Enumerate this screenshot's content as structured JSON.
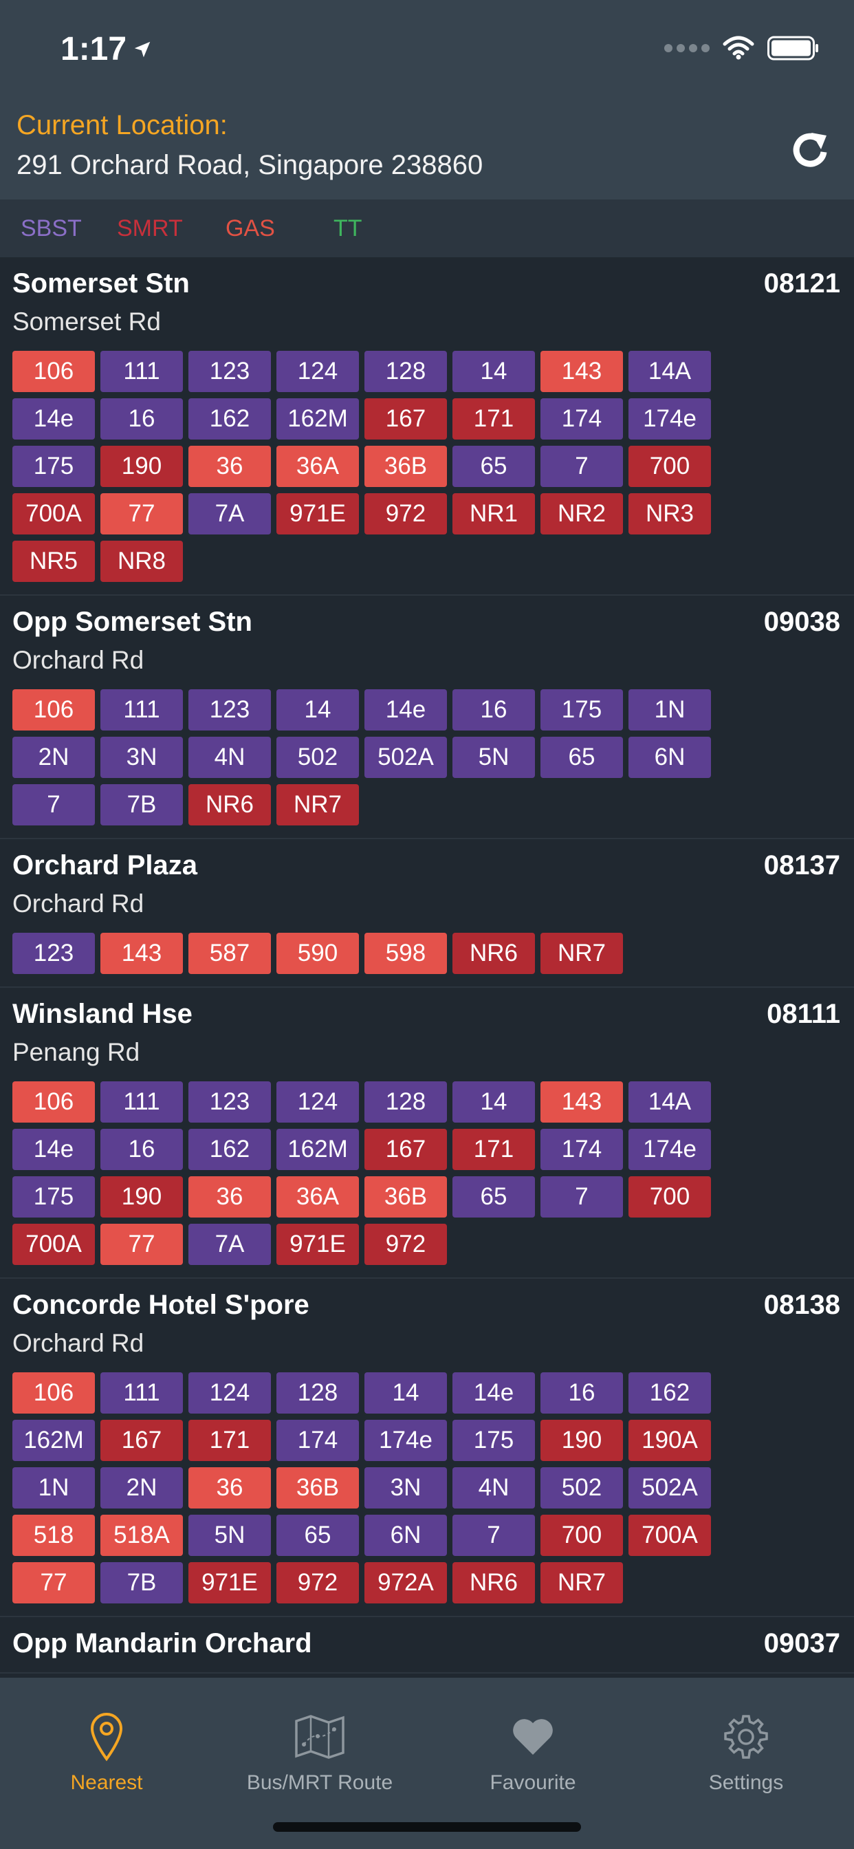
{
  "status": {
    "time": "1:17"
  },
  "header": {
    "location_label": "Current Location:",
    "address": "291 Orchard Road, Singapore 238860"
  },
  "legend": [
    {
      "label": "SBST",
      "color": "#8b6fc7"
    },
    {
      "label": "SMRT",
      "color": "#c8303b"
    },
    {
      "label": "GAS",
      "color": "#e25244"
    },
    {
      "label": "TT",
      "color": "#3fb55e"
    }
  ],
  "operator_colors": {
    "SBST": "#5c3f91",
    "SMRT": "#b22a32",
    "GAS": "#e4524b",
    "TT": "#2e9b4b"
  },
  "stops": [
    {
      "name": "Somerset Stn",
      "code": "08121",
      "road": "Somerset Rd",
      "services": [
        [
          "106",
          "GAS"
        ],
        [
          "111",
          "SBST"
        ],
        [
          "123",
          "SBST"
        ],
        [
          "124",
          "SBST"
        ],
        [
          "128",
          "SBST"
        ],
        [
          "14",
          "SBST"
        ],
        [
          "143",
          "GAS"
        ],
        [
          "14A",
          "SBST"
        ],
        [
          "14e",
          "SBST"
        ],
        [
          "16",
          "SBST"
        ],
        [
          "162",
          "SBST"
        ],
        [
          "162M",
          "SBST"
        ],
        [
          "167",
          "SMRT"
        ],
        [
          "171",
          "SMRT"
        ],
        [
          "174",
          "SBST"
        ],
        [
          "174e",
          "SBST"
        ],
        [
          "175",
          "SBST"
        ],
        [
          "190",
          "SMRT"
        ],
        [
          "36",
          "GAS"
        ],
        [
          "36A",
          "GAS"
        ],
        [
          "36B",
          "GAS"
        ],
        [
          "65",
          "SBST"
        ],
        [
          "7",
          "SBST"
        ],
        [
          "700",
          "SMRT"
        ],
        [
          "700A",
          "SMRT"
        ],
        [
          "77",
          "GAS"
        ],
        [
          "7A",
          "SBST"
        ],
        [
          "971E",
          "SMRT"
        ],
        [
          "972",
          "SMRT"
        ],
        [
          "NR1",
          "SMRT"
        ],
        [
          "NR2",
          "SMRT"
        ],
        [
          "NR3",
          "SMRT"
        ],
        [
          "NR5",
          "SMRT"
        ],
        [
          "NR8",
          "SMRT"
        ]
      ]
    },
    {
      "name": "Opp Somerset Stn",
      "code": "09038",
      "road": "Orchard Rd",
      "services": [
        [
          "106",
          "GAS"
        ],
        [
          "111",
          "SBST"
        ],
        [
          "123",
          "SBST"
        ],
        [
          "14",
          "SBST"
        ],
        [
          "14e",
          "SBST"
        ],
        [
          "16",
          "SBST"
        ],
        [
          "175",
          "SBST"
        ],
        [
          "1N",
          "SBST"
        ],
        [
          "2N",
          "SBST"
        ],
        [
          "3N",
          "SBST"
        ],
        [
          "4N",
          "SBST"
        ],
        [
          "502",
          "SBST"
        ],
        [
          "502A",
          "SBST"
        ],
        [
          "5N",
          "SBST"
        ],
        [
          "65",
          "SBST"
        ],
        [
          "6N",
          "SBST"
        ],
        [
          "7",
          "SBST"
        ],
        [
          "7B",
          "SBST"
        ],
        [
          "NR6",
          "SMRT"
        ],
        [
          "NR7",
          "SMRT"
        ]
      ]
    },
    {
      "name": "Orchard Plaza",
      "code": "08137",
      "road": "Orchard Rd",
      "services": [
        [
          "123",
          "SBST"
        ],
        [
          "143",
          "GAS"
        ],
        [
          "587",
          "GAS"
        ],
        [
          "590",
          "GAS"
        ],
        [
          "598",
          "GAS"
        ],
        [
          "NR6",
          "SMRT"
        ],
        [
          "NR7",
          "SMRT"
        ]
      ]
    },
    {
      "name": "Winsland Hse",
      "code": "08111",
      "road": "Penang Rd",
      "services": [
        [
          "106",
          "GAS"
        ],
        [
          "111",
          "SBST"
        ],
        [
          "123",
          "SBST"
        ],
        [
          "124",
          "SBST"
        ],
        [
          "128",
          "SBST"
        ],
        [
          "14",
          "SBST"
        ],
        [
          "143",
          "GAS"
        ],
        [
          "14A",
          "SBST"
        ],
        [
          "14e",
          "SBST"
        ],
        [
          "16",
          "SBST"
        ],
        [
          "162",
          "SBST"
        ],
        [
          "162M",
          "SBST"
        ],
        [
          "167",
          "SMRT"
        ],
        [
          "171",
          "SMRT"
        ],
        [
          "174",
          "SBST"
        ],
        [
          "174e",
          "SBST"
        ],
        [
          "175",
          "SBST"
        ],
        [
          "190",
          "SMRT"
        ],
        [
          "36",
          "GAS"
        ],
        [
          "36A",
          "GAS"
        ],
        [
          "36B",
          "GAS"
        ],
        [
          "65",
          "SBST"
        ],
        [
          "7",
          "SBST"
        ],
        [
          "700",
          "SMRT"
        ],
        [
          "700A",
          "SMRT"
        ],
        [
          "77",
          "GAS"
        ],
        [
          "7A",
          "SBST"
        ],
        [
          "971E",
          "SMRT"
        ],
        [
          "972",
          "SMRT"
        ]
      ]
    },
    {
      "name": "Concorde Hotel S'pore",
      "code": "08138",
      "road": "Orchard Rd",
      "services": [
        [
          "106",
          "GAS"
        ],
        [
          "111",
          "SBST"
        ],
        [
          "124",
          "SBST"
        ],
        [
          "128",
          "SBST"
        ],
        [
          "14",
          "SBST"
        ],
        [
          "14e",
          "SBST"
        ],
        [
          "16",
          "SBST"
        ],
        [
          "162",
          "SBST"
        ],
        [
          "162M",
          "SBST"
        ],
        [
          "167",
          "SMRT"
        ],
        [
          "171",
          "SMRT"
        ],
        [
          "174",
          "SBST"
        ],
        [
          "174e",
          "SBST"
        ],
        [
          "175",
          "SBST"
        ],
        [
          "190",
          "SMRT"
        ],
        [
          "190A",
          "SMRT"
        ],
        [
          "1N",
          "SBST"
        ],
        [
          "2N",
          "SBST"
        ],
        [
          "36",
          "GAS"
        ],
        [
          "36B",
          "GAS"
        ],
        [
          "3N",
          "SBST"
        ],
        [
          "4N",
          "SBST"
        ],
        [
          "502",
          "SBST"
        ],
        [
          "502A",
          "SBST"
        ],
        [
          "518",
          "GAS"
        ],
        [
          "518A",
          "GAS"
        ],
        [
          "5N",
          "SBST"
        ],
        [
          "65",
          "SBST"
        ],
        [
          "6N",
          "SBST"
        ],
        [
          "7",
          "SBST"
        ],
        [
          "700",
          "SMRT"
        ],
        [
          "700A",
          "SMRT"
        ],
        [
          "77",
          "GAS"
        ],
        [
          "7B",
          "SBST"
        ],
        [
          "971E",
          "SMRT"
        ],
        [
          "972",
          "SMRT"
        ],
        [
          "972A",
          "SMRT"
        ],
        [
          "NR6",
          "SMRT"
        ],
        [
          "NR7",
          "SMRT"
        ]
      ]
    },
    {
      "name": "Opp Mandarin Orchard",
      "code": "09037",
      "road": "",
      "services": []
    }
  ],
  "tabs": [
    {
      "label": "Nearest",
      "icon": "location-pin-icon",
      "active": true
    },
    {
      "label": "Bus/MRT Route",
      "icon": "route-map-icon",
      "active": false
    },
    {
      "label": "Favourite",
      "icon": "heart-icon",
      "active": false
    },
    {
      "label": "Settings",
      "icon": "gear-icon",
      "active": false
    }
  ]
}
